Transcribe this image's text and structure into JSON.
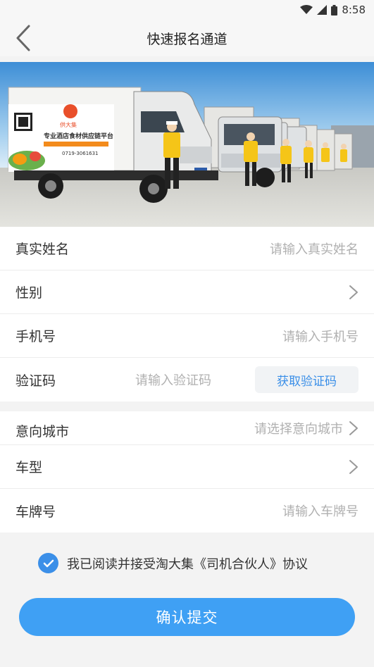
{
  "status": {
    "time": "8:58"
  },
  "nav": {
    "title": "快速报名通道"
  },
  "banner": {
    "truck_brand": "供大集",
    "truck_slogan": "专业酒店食材供应链平台",
    "truck_phone": "0719-3061631"
  },
  "form1": {
    "name_label": "真实姓名",
    "name_placeholder": "请输入真实姓名",
    "gender_label": "性别",
    "phone_label": "手机号",
    "phone_placeholder": "请输入手机号",
    "code_label": "验证码",
    "code_placeholder": "请输入验证码",
    "code_button": "获取验证码"
  },
  "form2": {
    "city_label": "意向城市",
    "city_placeholder": "请选择意向城市",
    "car_type_label": "车型",
    "plate_label": "车牌号",
    "plate_placeholder": "请输入车牌号"
  },
  "agreement": {
    "text": "我已阅读并接受淘大集《司机合伙人》协议",
    "checked": true
  },
  "submit": {
    "label": "确认提交"
  },
  "colors": {
    "accent": "#3b8fe8",
    "button": "#3fa0f4"
  }
}
